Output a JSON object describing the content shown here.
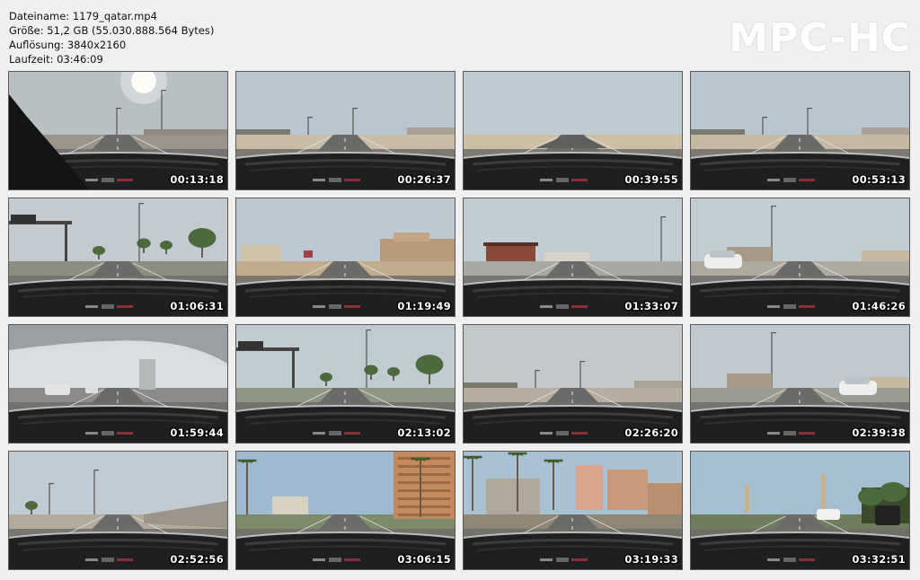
{
  "file_info": {
    "filename": "Dateiname: 1179_qatar.mp4",
    "size": "Größe: 51,2 GB (55.030.888.564 Bytes)",
    "resolution": "Auflösung: 3840x2160",
    "duration": "Laufzeit: 03:46:09"
  },
  "logo": "MPC-HC",
  "thumbnails": [
    {
      "timestamp": "00:13:18",
      "scene": "sun-highway",
      "sky": "#b8c0c4",
      "ground": "#9a948a"
    },
    {
      "timestamp": "00:26:37",
      "scene": "highway",
      "sky": "#b9c6cf",
      "ground": "#c9bda8"
    },
    {
      "timestamp": "00:39:55",
      "scene": "desert",
      "sky": "#bfcbd3",
      "ground": "#cdbfa4"
    },
    {
      "timestamp": "00:53:13",
      "scene": "highway",
      "sky": "#bac6cf",
      "ground": "#c6b9a3"
    },
    {
      "timestamp": "01:06:31",
      "scene": "trees-sign",
      "sky": "#c4cbd0",
      "ground": "#8c8f80"
    },
    {
      "timestamp": "01:19:49",
      "scene": "buildings",
      "sky": "#bcc8d2",
      "ground": "#c1ac8e"
    },
    {
      "timestamp": "01:33:07",
      "scene": "stadium",
      "sky": "#c2ccd3",
      "ground": "#a7a9a3"
    },
    {
      "timestamp": "01:46:26",
      "scene": "car-road",
      "sky": "#c3cdd4",
      "ground": "#aeaaa0"
    },
    {
      "timestamp": "01:59:44",
      "scene": "bridge",
      "sky": "#d9dee0",
      "ground": "#8a8c8a"
    },
    {
      "timestamp": "02:13:02",
      "scene": "trees-sign",
      "sky": "#c1cbd2",
      "ground": "#8f9583"
    },
    {
      "timestamp": "02:26:20",
      "scene": "highway",
      "sky": "#c3c8cb",
      "ground": "#b6ad9e"
    },
    {
      "timestamp": "02:39:38",
      "scene": "car-road",
      "sky": "#c0c9cf",
      "ground": "#9c9b92"
    },
    {
      "timestamp": "02:52:56",
      "scene": "wall",
      "sky": "#c1cbd3",
      "ground": "#b2aa9c"
    },
    {
      "timestamp": "03:06:15",
      "scene": "palms-tower",
      "sky": "#9fbad0",
      "ground": "#7e8a6c"
    },
    {
      "timestamp": "03:19:33",
      "scene": "palms-city",
      "sky": "#a9c1d3",
      "ground": "#8f8675"
    },
    {
      "timestamp": "03:32:51",
      "scene": "palms-park",
      "sky": "#a5bfd1",
      "ground": "#6f7d5e"
    }
  ]
}
